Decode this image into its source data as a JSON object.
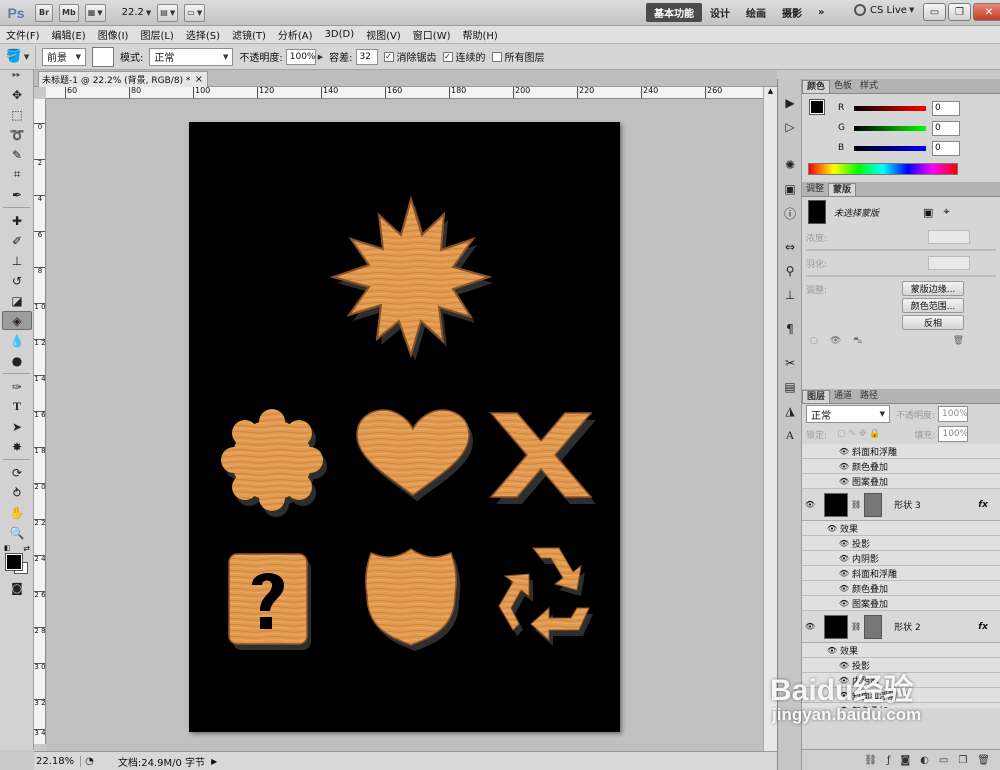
{
  "appbar": {
    "logo": "Ps",
    "btn_bridge": "Br",
    "btn_minibridge": "Mb",
    "zoom": "22.2",
    "workspaces": [
      "基本功能",
      "设计",
      "绘画",
      "摄影"
    ],
    "more": "»",
    "cslive": "CS Live",
    "win_min": "▭",
    "win_restore": "❐",
    "win_close": "✕"
  },
  "menubar": [
    "文件(F)",
    "编辑(E)",
    "图像(I)",
    "图层(L)",
    "选择(S)",
    "滤镜(T)",
    "分析(A)",
    "3D(D)",
    "视图(V)",
    "窗口(W)",
    "帮助(H)"
  ],
  "options": {
    "fill_source": "前景",
    "mode_label": "模式:",
    "mode_value": "正常",
    "opacity_label": "不透明度:",
    "opacity_value": "100%",
    "tolerance_label": "容差:",
    "tolerance_value": "32",
    "antialias_label": "消除锯齿",
    "contiguous_label": "连续的",
    "alllayers_label": "所有图层"
  },
  "document": {
    "tab_title": "未标题-1 @ 22.2% (背景, RGB/8) *",
    "ruler_top": [
      "60",
      "80",
      "100",
      "120",
      "140",
      "160",
      "180",
      "200",
      "220",
      "240",
      "260"
    ],
    "ruler_left": [
      "0",
      "2",
      "4",
      "6",
      "8",
      "1 0",
      "1 2",
      "1 4",
      "1 6",
      "1 8",
      "2 0",
      "2 2",
      "2 4",
      "2 6",
      "2 8",
      "3 0",
      "3 2",
      "3 4"
    ]
  },
  "status": {
    "zoom": "22.18%",
    "doc_info": "文档:24.9M/0 字节"
  },
  "panels": {
    "color_tabs": [
      "颜色",
      "色板",
      "样式"
    ],
    "channels": [
      {
        "letter": "R",
        "value": "0"
      },
      {
        "letter": "G",
        "value": "0"
      },
      {
        "letter": "B",
        "value": "0"
      }
    ],
    "adjust_tabs": [
      "调整",
      "蒙版"
    ],
    "mask_title": "未选择蒙版",
    "density_label": "浓度:",
    "feather_label": "羽化:",
    "adjust_label": "调整:",
    "btn_mask_edge": "蒙版边缘...",
    "btn_color_range": "颜色范围...",
    "btn_invert": "反相",
    "layers_tabs": [
      "图层",
      "通道",
      "路径"
    ],
    "blend_mode": "正常",
    "opacity_label": "不透明度:",
    "opacity_value": "100%",
    "lock_label": "锁定:",
    "fill_label": "填充:",
    "fill_value": "100%",
    "layers_top_effects": [
      "斜面和浮雕",
      "颜色叠加",
      "图案叠加"
    ],
    "layer3_name": "形状 3",
    "layer2_name": "形状 2",
    "effects_label": "效果",
    "effects": [
      "投影",
      "内阴影",
      "斜面和浮雕",
      "颜色叠加",
      "图案叠加"
    ],
    "fx": "fx"
  },
  "colors": {
    "shape_fill": "#e19a50",
    "shape_dark": "#8b5428"
  },
  "watermark": {
    "main": "Baidu经验",
    "sub": "jingyan.baidu.com"
  }
}
